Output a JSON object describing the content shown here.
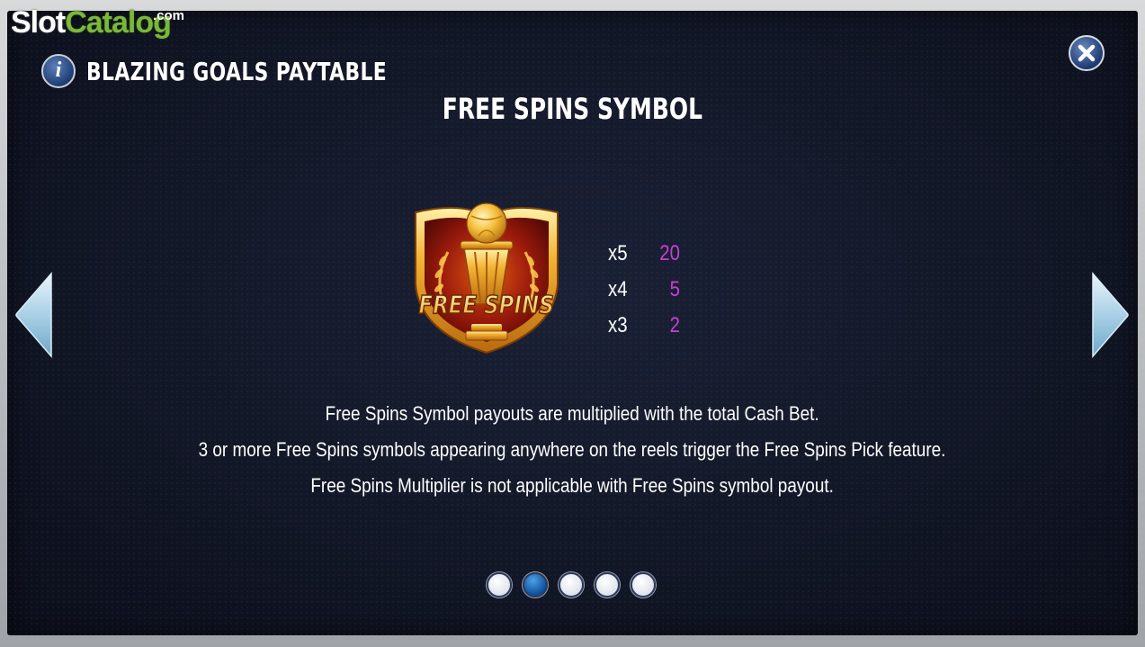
{
  "brand": {
    "slot": "Slot",
    "catalog": "Catalog",
    "com": ".com"
  },
  "header": {
    "title": "BLAZING GOALS PAYTABLE",
    "info_icon": "info-icon",
    "close_icon": "close-icon"
  },
  "section": {
    "title": "FREE SPINS SYMBOL"
  },
  "symbol": {
    "name": "free-spins-trophy-badge-icon",
    "label": "FREE SPINS"
  },
  "paytable": [
    {
      "count": "x5",
      "value": "20"
    },
    {
      "count": "x4",
      "value": "5"
    },
    {
      "count": "x3",
      "value": "2"
    }
  ],
  "description": [
    "Free Spins Symbol payouts are multiplied with the total Cash Bet.",
    "3 or more Free Spins symbols appearing anywhere on the reels trigger the Free Spins Pick feature.",
    "Free Spins Multiplier is not applicable with Free Spins symbol payout."
  ],
  "navigation": {
    "left_icon": "arrow-left-icon",
    "right_icon": "arrow-right-icon",
    "pages": 5,
    "active_page": 2
  },
  "colors": {
    "payout_value": "#c83fd6",
    "panel_background": "#121727",
    "accent_brand": "#7ab83a",
    "active_dot": "#0d4f9c"
  }
}
